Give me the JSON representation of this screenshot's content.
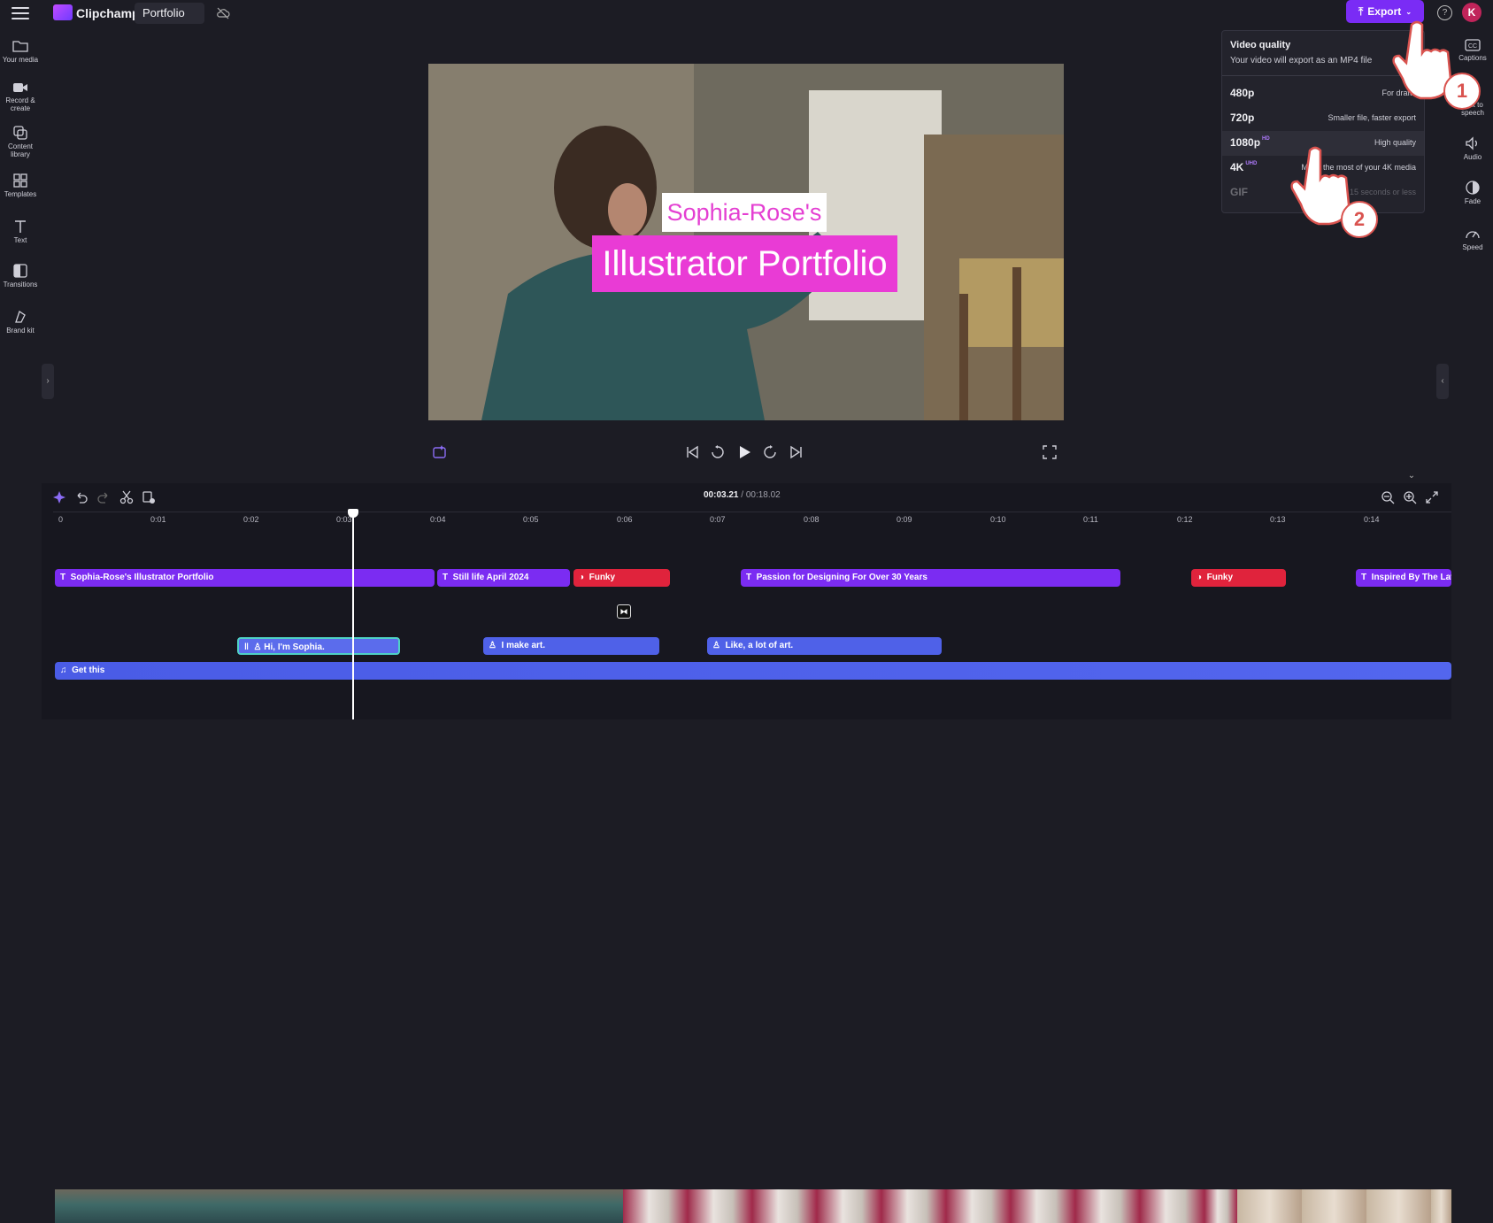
{
  "app": {
    "brand": "Clipchamp",
    "project_name": "Portfolio"
  },
  "header": {
    "export_label": "Export",
    "help": "?",
    "avatar_initial": "K"
  },
  "left_sidebar": [
    {
      "label": "Your media",
      "icon": "folder-icon"
    },
    {
      "label": "Record & create",
      "icon": "video-camera-icon"
    },
    {
      "label": "Content library",
      "icon": "content-library-icon"
    },
    {
      "label": "Templates",
      "icon": "templates-icon"
    },
    {
      "label": "Text",
      "icon": "text-icon"
    },
    {
      "label": "Transitions",
      "icon": "transitions-icon"
    },
    {
      "label": "Brand kit",
      "icon": "brand-kit-icon"
    }
  ],
  "right_sidebar": [
    {
      "label": "Captions",
      "icon": "captions-icon"
    },
    {
      "label": "Text to speech",
      "icon": "text-to-speech-icon"
    },
    {
      "label": "Audio",
      "icon": "speaker-icon"
    },
    {
      "label": "Fade",
      "icon": "fade-icon"
    },
    {
      "label": "Speed",
      "icon": "speedometer-icon"
    }
  ],
  "video_overlay": {
    "line1": "Sophia-Rose's",
    "line2": "Illustrator Portfolio"
  },
  "export_panel": {
    "title": "Video quality",
    "subtitle": "Your video will export as an MP4 file",
    "options": [
      {
        "name": "480p",
        "badge": "",
        "desc": "For drafts"
      },
      {
        "name": "720p",
        "badge": "",
        "desc": "Smaller file, faster export"
      },
      {
        "name": "1080p",
        "badge": "HD",
        "desc": "High quality"
      },
      {
        "name": "4K",
        "badge": "UHD",
        "desc": "Make the most of your 4K media"
      },
      {
        "name": "GIF",
        "badge": "",
        "desc": "For 15 seconds or less"
      }
    ],
    "step1": "1",
    "step2": "2"
  },
  "playback": {
    "current_time": "00:03.21",
    "total_time": "/ 00:18.02"
  },
  "ruler": [
    "0",
    "0:01",
    "0:02",
    "0:03",
    "0:04",
    "0:05",
    "0:06",
    "0:07",
    "0:08",
    "0:09",
    "0:10",
    "0:11",
    "0:12",
    "0:13",
    "0:14"
  ],
  "tracks": {
    "text_clips": [
      {
        "label": "Sophia-Rose's Illustrator Portfolio",
        "type": "text"
      },
      {
        "label": "Still life April 2024",
        "type": "text"
      },
      {
        "label": "Funky",
        "type": "sticker"
      },
      {
        "label": "Passion for Designing For Over 30 Years",
        "type": "text"
      },
      {
        "label": "Funky",
        "type": "sticker"
      },
      {
        "label": "Inspired By The Lat",
        "type": "text"
      }
    ],
    "voice_clips": [
      {
        "label": "Hi, I'm Sophia."
      },
      {
        "label": "I make art."
      },
      {
        "label": "Like, a lot of art."
      }
    ],
    "music_clip": {
      "label": "Get this"
    }
  },
  "colors": {
    "accent": "#7a2cf5",
    "text_clip": "#7b2cf2",
    "sticker_clip": "#e0233c",
    "voice_clip": "#4f61e8",
    "overlay_pink": "#e93bd5"
  }
}
